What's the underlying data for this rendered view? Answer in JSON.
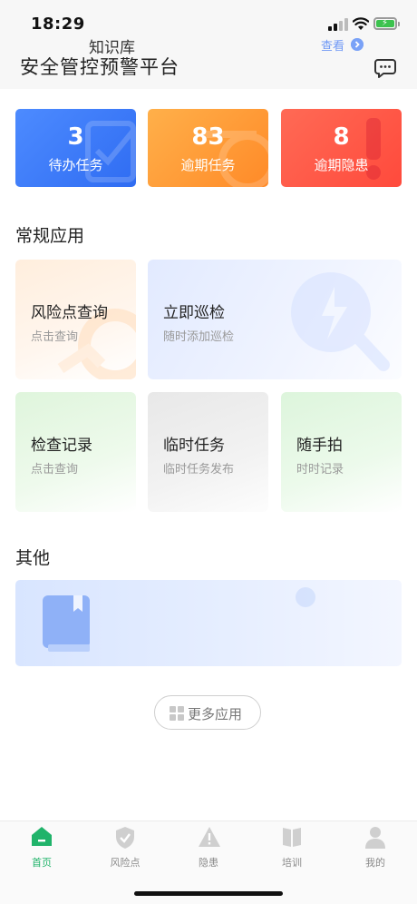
{
  "status_bar": {
    "time": "18:29"
  },
  "header": {
    "title": "安全管控预警平台",
    "message_icon": "chat-bubble-icon"
  },
  "stats": [
    {
      "value": "3",
      "label": "待办任务",
      "color": "#3d7cf8"
    },
    {
      "value": "83",
      "label": "逾期任务",
      "color": "#ff9a36"
    },
    {
      "value": "8",
      "label": "逾期隐患",
      "color": "#ff5b48"
    }
  ],
  "common_apps": {
    "title": "常规应用",
    "items": [
      {
        "title": "风险点查询",
        "subtitle": "点击查询"
      },
      {
        "title": "立即巡检",
        "subtitle": "随时添加巡检"
      },
      {
        "title": "检查记录",
        "subtitle": "点击查询"
      },
      {
        "title": "临时任务",
        "subtitle": "临时任务发布"
      },
      {
        "title": "随手拍",
        "subtitle": "时时记录"
      }
    ]
  },
  "other": {
    "title": "其他",
    "knowledge": {
      "label": "知识库",
      "view": "查看"
    }
  },
  "more_apps": {
    "label": "更多应用"
  },
  "tab_bar": {
    "accent": "#20b36a",
    "items": [
      {
        "label": "首页",
        "icon": "home-icon",
        "active": true
      },
      {
        "label": "风险点",
        "icon": "shield-icon",
        "active": false
      },
      {
        "label": "隐患",
        "icon": "warning-icon",
        "active": false
      },
      {
        "label": "培训",
        "icon": "book-icon",
        "active": false
      },
      {
        "label": "我的",
        "icon": "user-icon",
        "active": false
      }
    ]
  }
}
